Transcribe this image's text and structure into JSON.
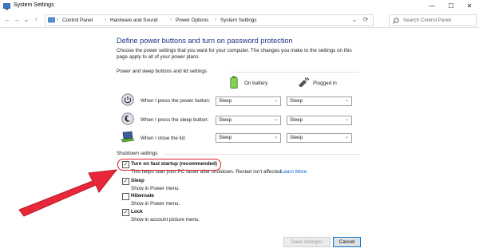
{
  "window": {
    "title": "System Settings",
    "controls": [
      "—",
      "☐",
      "✕"
    ]
  },
  "nav": {
    "back": "←",
    "forward": "→",
    "up_chevron": "⌄",
    "up": "↑",
    "breadcrumbs": [
      "Control Panel",
      "Hardware and Sound",
      "Power Options",
      "System Settings"
    ],
    "dropdown": "⌄",
    "refresh": "⟳"
  },
  "search": {
    "placeholder": "Search Control Panel"
  },
  "page": {
    "heading": "Define power buttons and turn on password protection",
    "description": "Choose the power settings that you want for your computer. The changes you make to the settings on this page apply to all of your power plans."
  },
  "power_section": {
    "title": "Power and sleep buttons and lid settings",
    "col_battery": "On battery",
    "col_plugged": "Plugged in",
    "rows": [
      {
        "label": "When I press the power button:",
        "battery": "Sleep",
        "plugged": "Sleep"
      },
      {
        "label": "When I press the sleep button:",
        "battery": "Sleep",
        "plugged": "Sleep"
      },
      {
        "label": "When I close the lid:",
        "battery": "Sleep",
        "plugged": "Sleep"
      }
    ]
  },
  "shutdown": {
    "title": "Shutdown settings",
    "options": [
      {
        "label": "Turn on fast startup (recommended)",
        "checked": true,
        "desc": "This helps start your PC faster after shutdown. Restart isn't affected.",
        "link": "Learn More"
      },
      {
        "label": "Sleep",
        "checked": true,
        "desc": "Show in Power menu."
      },
      {
        "label": "Hibernate",
        "checked": false,
        "desc": "Show in Power menu."
      },
      {
        "label": "Lock",
        "checked": true,
        "desc": "Show in account picture menu."
      }
    ]
  },
  "buttons": {
    "save": "Save changes",
    "cancel": "Cancel"
  },
  "colors": {
    "heading": "#1e3287",
    "link": "#0066cc",
    "highlight": "#d9242b",
    "arrow": "#e8283a"
  }
}
